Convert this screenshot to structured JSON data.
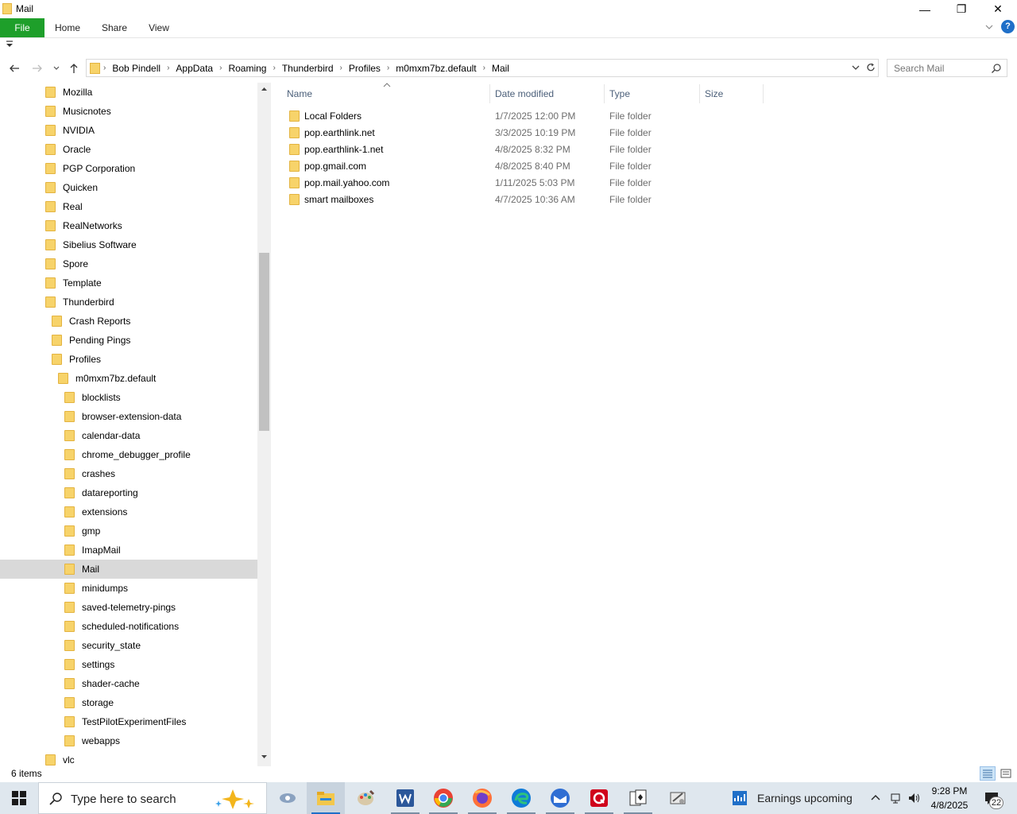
{
  "window": {
    "title": "Mail",
    "minimize_glyph": "—",
    "restore_glyph": "❐",
    "close_glyph": "✕"
  },
  "ribbon": {
    "tabs": [
      "File",
      "Home",
      "Share",
      "View"
    ]
  },
  "address": {
    "crumbs": [
      "Bob Pindell",
      "AppData",
      "Roaming",
      "Thunderbird",
      "Profiles",
      "m0mxm7bz.default",
      "Mail"
    ],
    "search_placeholder": "Search Mail"
  },
  "nav_tree": [
    {
      "label": "Mozilla",
      "level": 0
    },
    {
      "label": "Musicnotes",
      "level": 0
    },
    {
      "label": "NVIDIA",
      "level": 0
    },
    {
      "label": "Oracle",
      "level": 0
    },
    {
      "label": "PGP Corporation",
      "level": 0
    },
    {
      "label": "Quicken",
      "level": 0
    },
    {
      "label": "Real",
      "level": 0
    },
    {
      "label": "RealNetworks",
      "level": 0
    },
    {
      "label": "Sibelius Software",
      "level": 0
    },
    {
      "label": "Spore",
      "level": 0
    },
    {
      "label": "Template",
      "level": 0
    },
    {
      "label": "Thunderbird",
      "level": 0
    },
    {
      "label": "Crash Reports",
      "level": 1
    },
    {
      "label": "Pending Pings",
      "level": 1
    },
    {
      "label": "Profiles",
      "level": 1
    },
    {
      "label": "m0mxm7bz.default",
      "level": 2
    },
    {
      "label": "blocklists",
      "level": 3
    },
    {
      "label": "browser-extension-data",
      "level": 3
    },
    {
      "label": "calendar-data",
      "level": 3
    },
    {
      "label": "chrome_debugger_profile",
      "level": 3
    },
    {
      "label": "crashes",
      "level": 3
    },
    {
      "label": "datareporting",
      "level": 3
    },
    {
      "label": "extensions",
      "level": 3
    },
    {
      "label": "gmp",
      "level": 3
    },
    {
      "label": "ImapMail",
      "level": 3
    },
    {
      "label": "Mail",
      "level": 3,
      "selected": true
    },
    {
      "label": "minidumps",
      "level": 3
    },
    {
      "label": "saved-telemetry-pings",
      "level": 3
    },
    {
      "label": "scheduled-notifications",
      "level": 3
    },
    {
      "label": "security_state",
      "level": 3
    },
    {
      "label": "settings",
      "level": 3
    },
    {
      "label": "shader-cache",
      "level": 3
    },
    {
      "label": "storage",
      "level": 3
    },
    {
      "label": "TestPilotExperimentFiles",
      "level": 3
    },
    {
      "label": "webapps",
      "level": 3
    },
    {
      "label": "vlc",
      "level": 0
    }
  ],
  "columns": {
    "name": "Name",
    "date": "Date modified",
    "type": "Type",
    "size": "Size"
  },
  "files": [
    {
      "name": "Local Folders",
      "date": "1/7/2025 12:00 PM",
      "type": "File folder"
    },
    {
      "name": "pop.earthlink.net",
      "date": "3/3/2025 10:19 PM",
      "type": "File folder"
    },
    {
      "name": "pop.earthlink-1.net",
      "date": "4/8/2025 8:32 PM",
      "type": "File folder"
    },
    {
      "name": "pop.gmail.com",
      "date": "4/8/2025 8:40 PM",
      "type": "File folder"
    },
    {
      "name": "pop.mail.yahoo.com",
      "date": "1/11/2025 5:03 PM",
      "type": "File folder"
    },
    {
      "name": "smart mailboxes",
      "date": "4/7/2025 10:36 AM",
      "type": "File folder"
    }
  ],
  "status": {
    "item_count": "6 items"
  },
  "taskbar": {
    "search_placeholder": "Type here to search",
    "news_text": "Earnings upcoming",
    "time": "9:28 PM",
    "date": "4/8/2025",
    "notification_count": "22",
    "colors": {
      "word": "#2b579a",
      "chrome": "#e94235",
      "firefox": "#ff7139",
      "edge": "#0f7bd8",
      "thunderbird": "#2f6ed3",
      "quicken": "#d0021b"
    }
  }
}
